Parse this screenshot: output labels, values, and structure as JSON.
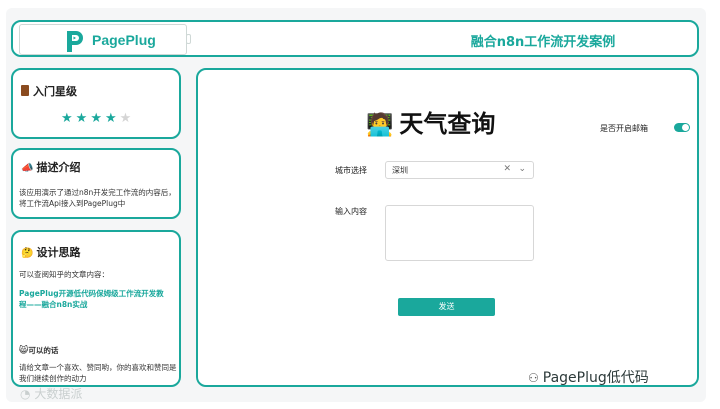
{
  "header": {
    "logo_text": "PagePlug",
    "title": "融合n8n工作流开发案例"
  },
  "sidebar": {
    "level_card": {
      "title": "入门星级",
      "icon": "door-icon",
      "stars_filled": 4,
      "stars_total": 5
    },
    "intro_card": {
      "title": "描述介绍",
      "icon": "megaphone-icon",
      "text": "该应用演示了通过n8n开发完工作流的内容后，将工作流Api接入到PagePlug中"
    },
    "design_card": {
      "title": "设计思路",
      "icon": "thinking-face-icon",
      "line1": "可以查阅知乎的文章内容：",
      "link": "PagePlug开源低代码保姆级工作流开发教程——融合n8n实战",
      "sub_title": "可以的话",
      "footer": "请给文章一个喜欢、赞同哟，你的喜欢和赞同是我们继续创作的动力"
    }
  },
  "main": {
    "title": "天气查询",
    "title_icon": "technologist-icon",
    "email_toggle_label": "是否开启邮箱",
    "email_toggle_on": true,
    "city_label": "城市选择",
    "city_value": "深圳",
    "input_label": "输入内容",
    "input_value": "",
    "send_label": "发送"
  },
  "watermarks": {
    "right": "PagePlug低代码",
    "left": "大数据派"
  },
  "colors": {
    "accent": "#1aa89c"
  }
}
